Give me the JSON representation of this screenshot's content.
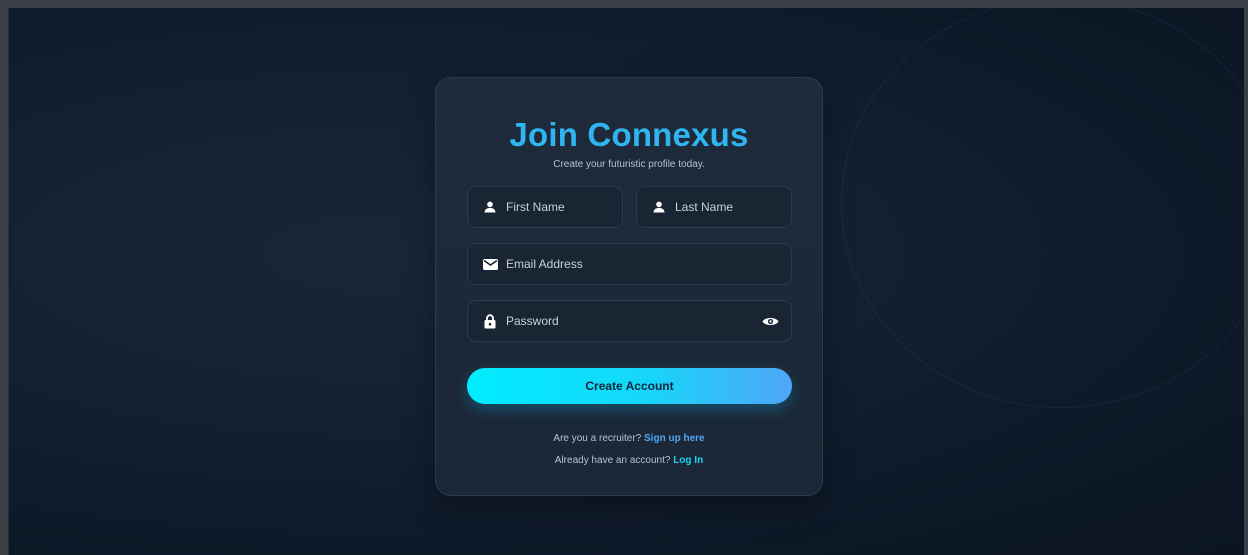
{
  "signup": {
    "title": "Join Connexus",
    "subtitle": "Create your futuristic profile today.",
    "first_name": {
      "placeholder": "First Name",
      "icon": "user-icon"
    },
    "last_name": {
      "placeholder": "Last Name",
      "icon": "user-icon"
    },
    "email": {
      "placeholder": "Email Address",
      "icon": "envelope-icon"
    },
    "password": {
      "placeholder": "Password",
      "icon": "lock-icon",
      "toggle_icon": "eye-icon"
    },
    "submit_label": "Create Account",
    "recruiter_prompt": "Are you a recruiter?",
    "recruiter_link": "Sign up here",
    "login_prompt": "Already have an account?",
    "login_link": "Log In"
  },
  "colors": {
    "accent": "#2fb6f0",
    "button_start": "#00ecff",
    "button_end": "#4fa6f7",
    "link_recruiter": "#52a7f5",
    "link_login": "#18d4f7"
  }
}
